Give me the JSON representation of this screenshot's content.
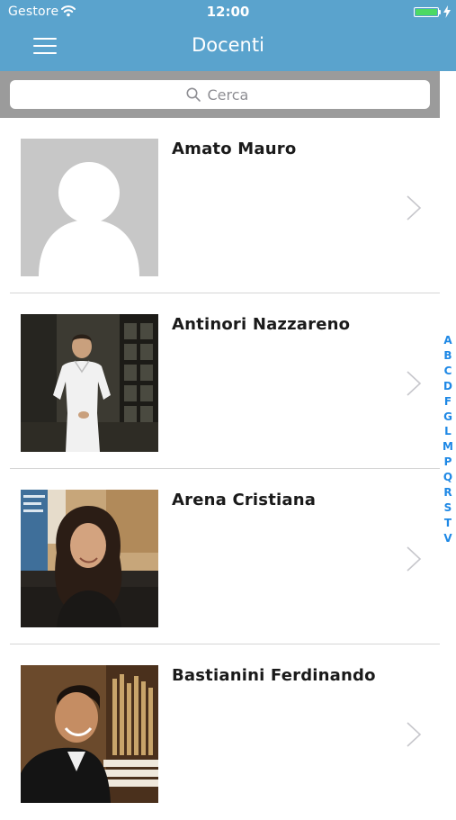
{
  "status_bar": {
    "carrier": "Gestore",
    "time": "12:00",
    "battery_level": 1.0
  },
  "nav": {
    "title": "Docenti",
    "menu_icon": "hamburger-icon"
  },
  "search": {
    "placeholder": "Cerca",
    "icon": "search-icon"
  },
  "teachers": [
    {
      "name": "Amato Mauro",
      "photo": "placeholder-avatar"
    },
    {
      "name": "Antinori Nazzareno",
      "photo": "photo"
    },
    {
      "name": "Arena Cristiana",
      "photo": "photo"
    },
    {
      "name": "Bastianini Ferdinando",
      "photo": "photo"
    }
  ],
  "index_letters": [
    "A",
    "B",
    "C",
    "D",
    "F",
    "G",
    "L",
    "M",
    "P",
    "Q",
    "R",
    "S",
    "T",
    "V"
  ],
  "colors": {
    "nav_bar": "#5aa3cd",
    "index_letters": "#1e88e5",
    "battery": "#4cd964"
  }
}
